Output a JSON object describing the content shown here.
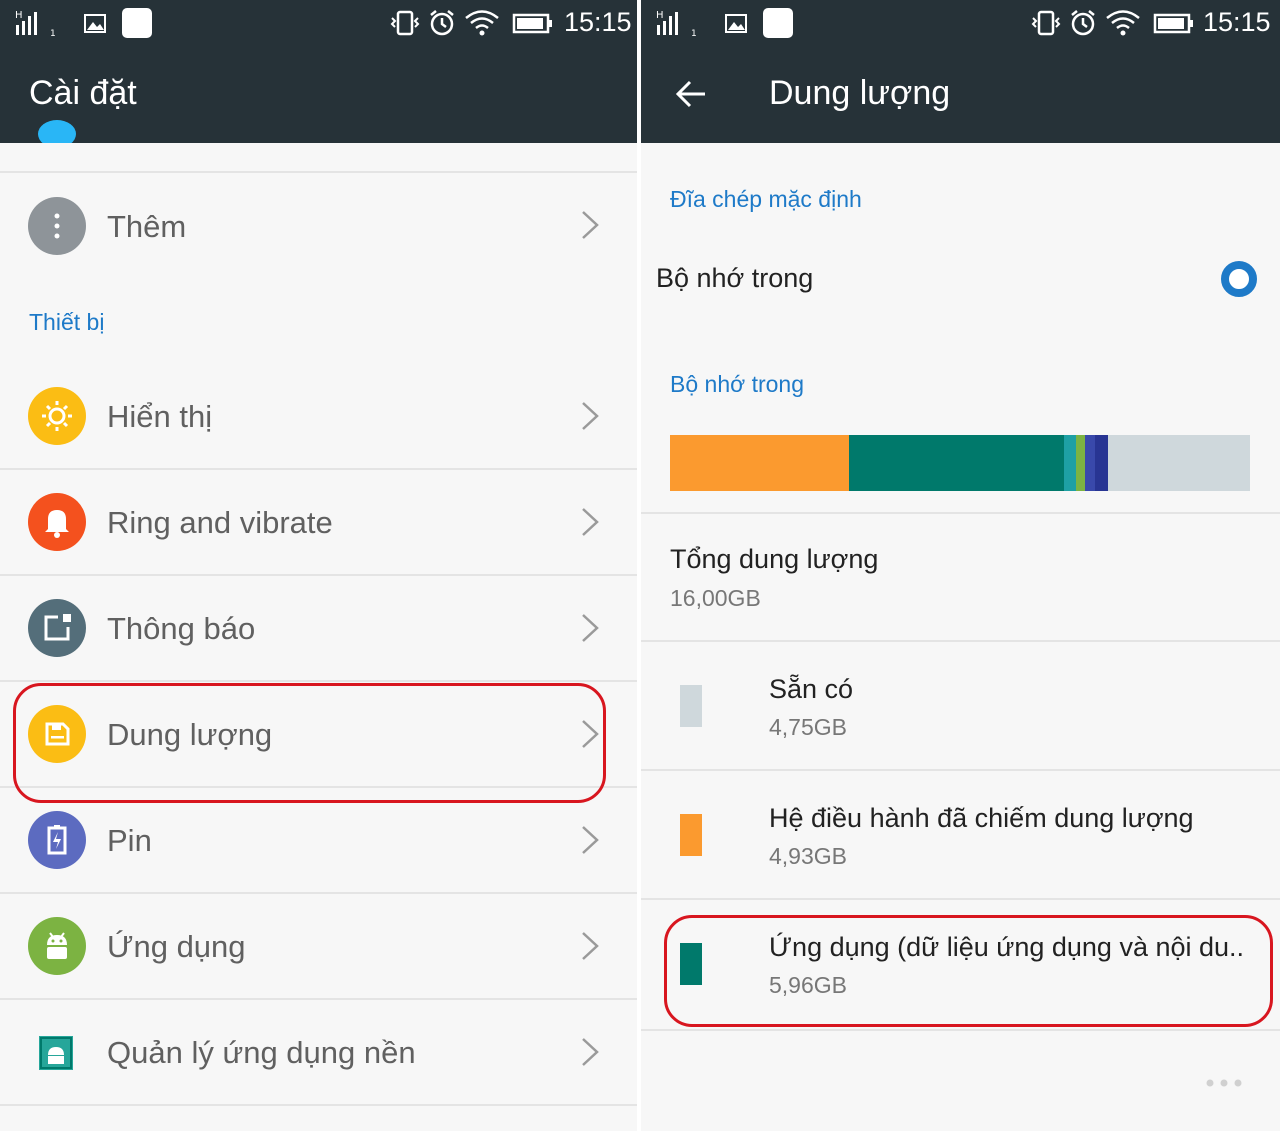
{
  "status_bar": {
    "time": "15:15",
    "signal_icon": "signal-h-icon",
    "gallery_icon": "image-notification-icon",
    "vibrate_icon": "vibrate-icon",
    "alarm_icon": "alarm-icon",
    "wifi_icon": "wifi-icon",
    "battery_icon": "battery-icon"
  },
  "settings": {
    "title": "Cài đặt",
    "items_top": [
      {
        "label": "Thêm",
        "icon": "more-icon",
        "color": "#8e9499"
      }
    ],
    "section_device": "Thiết bị",
    "items": [
      {
        "label": "Hiển thị",
        "icon": "brightness-icon",
        "color": "#fbbd14"
      },
      {
        "label": "Ring and vibrate",
        "icon": "bell-icon",
        "color": "#f4511e"
      },
      {
        "label": "Thông báo",
        "icon": "notification-icon",
        "color": "#546e7a"
      },
      {
        "label": "Dung lượng",
        "icon": "storage-icon",
        "color": "#fbbd14"
      },
      {
        "label": "Pin",
        "icon": "battery-icon",
        "color": "#5c6bc0"
      },
      {
        "label": "Ứng dụng",
        "icon": "android-icon",
        "color": "#7cb342"
      },
      {
        "label": "Quản lý ứng dụng nền",
        "icon": "android-square-icon",
        "color": "#26a69a"
      }
    ]
  },
  "storage": {
    "title": "Dung lượng",
    "default_disk_header": "Đĩa chép mặc định",
    "internal_option": "Bộ nhớ trong",
    "internal_header": "Bộ nhớ trong",
    "usage_bar": [
      {
        "name": "os",
        "fraction": 0.308,
        "color": "#fb9a2f"
      },
      {
        "name": "apps",
        "fraction": 0.372,
        "color": "#00796b"
      },
      {
        "name": "other1",
        "fraction": 0.02,
        "color": "#1ea0a4"
      },
      {
        "name": "other2",
        "fraction": 0.016,
        "color": "#7cb342"
      },
      {
        "name": "other3",
        "fraction": 0.016,
        "color": "#3949ab"
      },
      {
        "name": "other4",
        "fraction": 0.024,
        "color": "#283593"
      },
      {
        "name": "available",
        "fraction": 0.244,
        "color": "#cfd8dc"
      }
    ],
    "total": {
      "label": "Tổng dung lượng",
      "value": "16,00GB"
    },
    "entries": [
      {
        "label": "Sẵn có",
        "value": "4,75GB",
        "color": "#cfd8dc"
      },
      {
        "label": "Hệ điều hành đã chiếm dung lượng",
        "value": "4,93GB",
        "color": "#fb9a2f"
      },
      {
        "label": "Ứng dụng (dữ liệu ứng dụng và nội du..",
        "value": "5,96GB",
        "color": "#00796b"
      }
    ]
  }
}
